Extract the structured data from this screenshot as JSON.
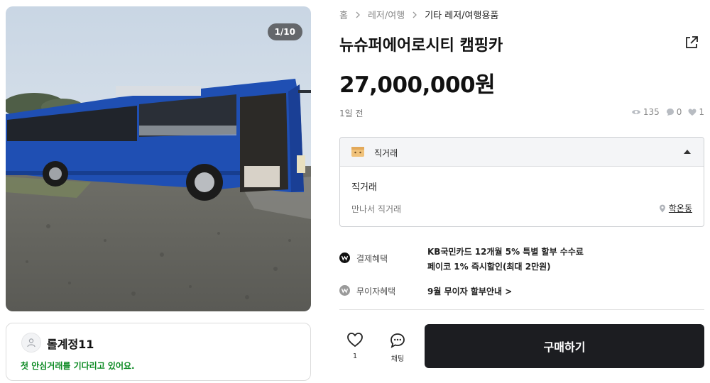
{
  "photo": {
    "counter": "1/10"
  },
  "seller": {
    "name": "롤계정11",
    "status": "첫 안심거래를 기다리고 있어요."
  },
  "breadcrumb": {
    "items": [
      "홈",
      "레저/여행",
      "기타 레저/여행용품"
    ]
  },
  "product": {
    "title": "뉴슈퍼에어로시티 캠핑카",
    "price": "27,000,000원",
    "time": "1일 전",
    "views": "135",
    "chats": "0",
    "likes": "1"
  },
  "trade": {
    "header": "직거래",
    "type": "직거래",
    "sub": "만나서 직거래",
    "location": "학온동"
  },
  "benefits": {
    "payment_label": "결제혜택",
    "payment_lines": [
      "KB국민카드 12개월 5% 특별 할부 수수료",
      "페이코 1% 즉시할인(최대 2만원)"
    ],
    "interest_label": "무이자혜택",
    "interest_line": "9월 무이자 할부안내 >"
  },
  "actions": {
    "like_count": "1",
    "chat_label": "채팅",
    "buy_label": "구매하기"
  },
  "colors": {
    "bus_blue": "#1f4fb3",
    "seller_status": "#0c8a23",
    "buy_button": "#1c1d21"
  },
  "icons": [
    "user-icon",
    "chevron-right-icon",
    "share-icon",
    "eye-icon",
    "chat-bubble-icon",
    "heart-icon",
    "box-icon",
    "caret-up-icon",
    "location-pin-icon",
    "payment-benefit-icon",
    "interest-benefit-icon"
  ]
}
